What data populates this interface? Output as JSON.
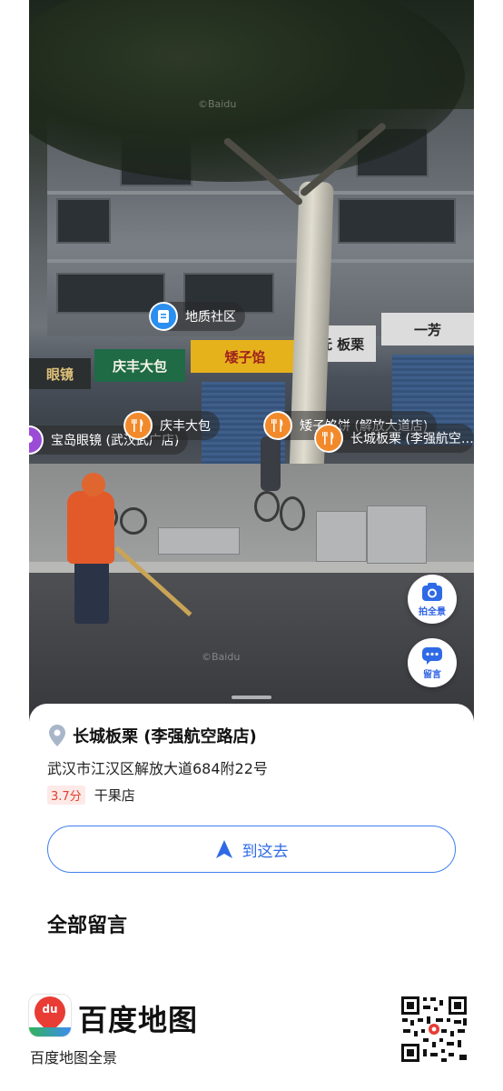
{
  "panorama": {
    "watermark_top": "©Baidu",
    "watermark_bottom": "©Baidu",
    "street_signs": {
      "sign_1": "眼镜",
      "sign_2": "庆丰大包",
      "sign_3": "矮子馅",
      "sign_4": "抚 板栗",
      "sign_5": "一芳"
    },
    "poi_markers": [
      {
        "label": "地质社区",
        "icon": "document-icon",
        "color": "#2a8ff0"
      },
      {
        "label": "宝岛眼镜 (武汉武广店)",
        "icon": "location-icon",
        "color": "#9a4cd6"
      },
      {
        "label": "庆丰大包",
        "icon": "fork-knife-icon",
        "color": "#f28a2b"
      },
      {
        "label": "矮子馅饼 (解放大道店)",
        "icon": "fork-knife-icon",
        "color": "#f28a2b"
      },
      {
        "label": "长城板栗 (李强航空…",
        "icon": "fork-knife-icon",
        "color": "#f28a2b"
      }
    ],
    "actions": {
      "photo_label": "拍全景",
      "comment_label": "留言"
    }
  },
  "sheet": {
    "title": "长城板栗 (李强航空路店)",
    "address": "武汉市江汉区解放大道684附22号",
    "rating": "3.7分",
    "category": "干果店",
    "nav_label": "到这去",
    "comments_title": "全部留言"
  },
  "footer": {
    "logo_text": "du",
    "brand": "百度地图",
    "caption": "百度地图全景"
  },
  "colors": {
    "accent": "#2f6ae6",
    "rating_red": "#e0412c",
    "poi_orange": "#f28a2b",
    "poi_blue": "#2a8ff0",
    "poi_purple": "#9a4cd6"
  }
}
